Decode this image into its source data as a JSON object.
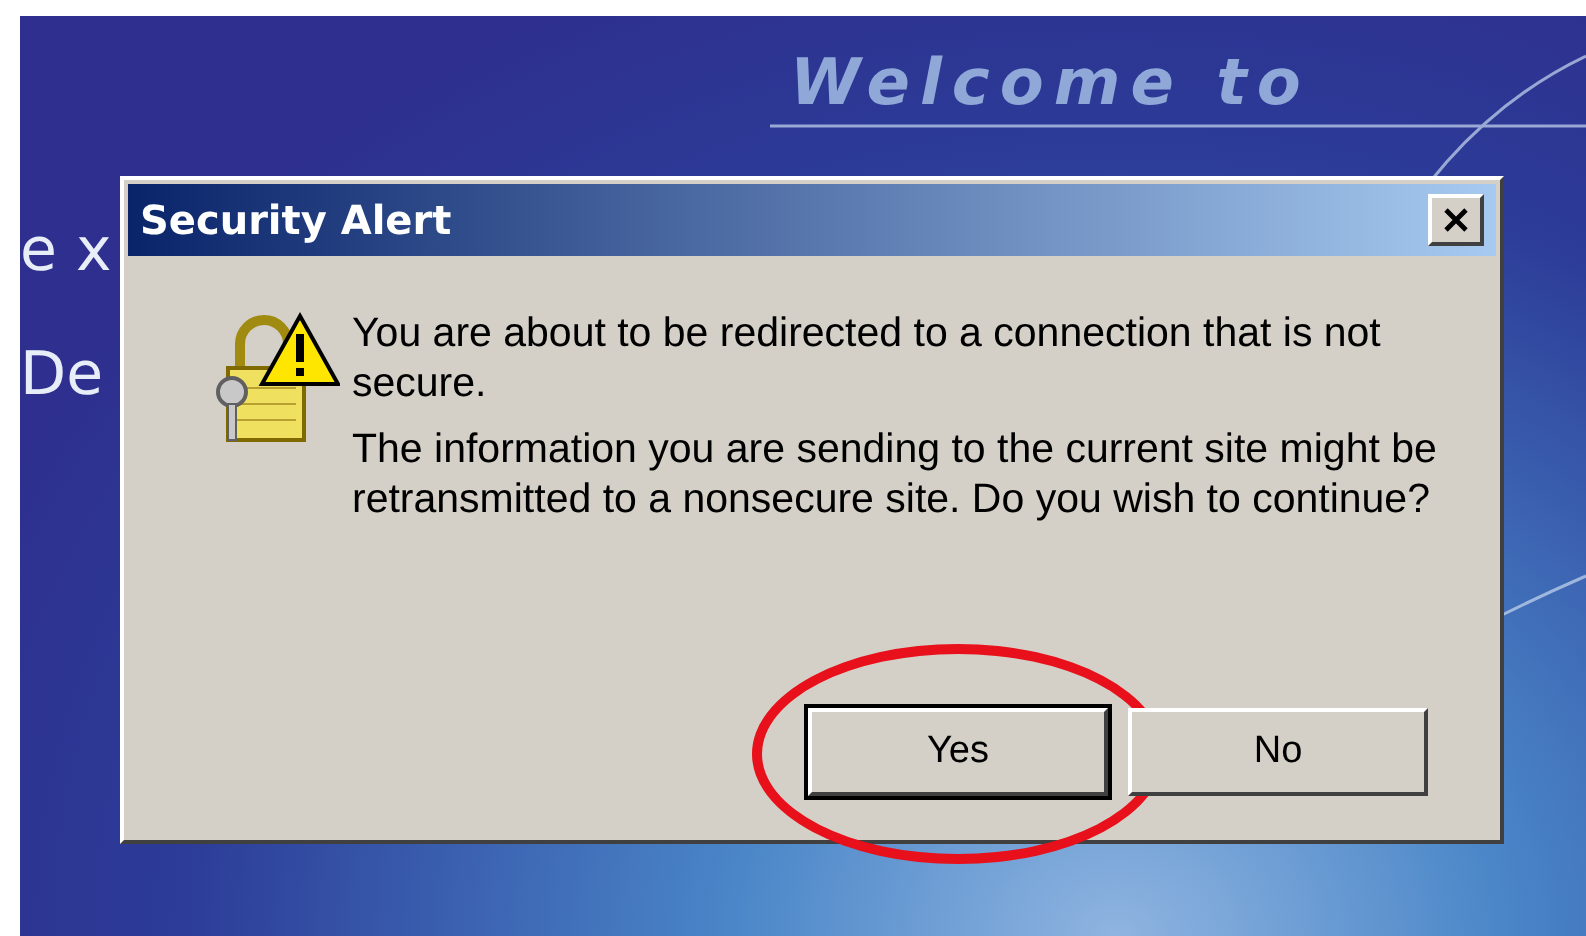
{
  "page": {
    "heading": "Welcome to",
    "partial_texts": [
      "e x",
      "De"
    ]
  },
  "dialog": {
    "title": "Security Alert",
    "messages": [
      "You are about to be redirected to a connection that is not secure.",
      "The information you are sending to the current site might be retransmitted to a nonsecure site. Do you wish to continue?"
    ],
    "buttons": [
      {
        "label": "Yes",
        "default": true,
        "circled": true
      },
      {
        "label": "No",
        "default": false,
        "circled": false
      }
    ]
  }
}
